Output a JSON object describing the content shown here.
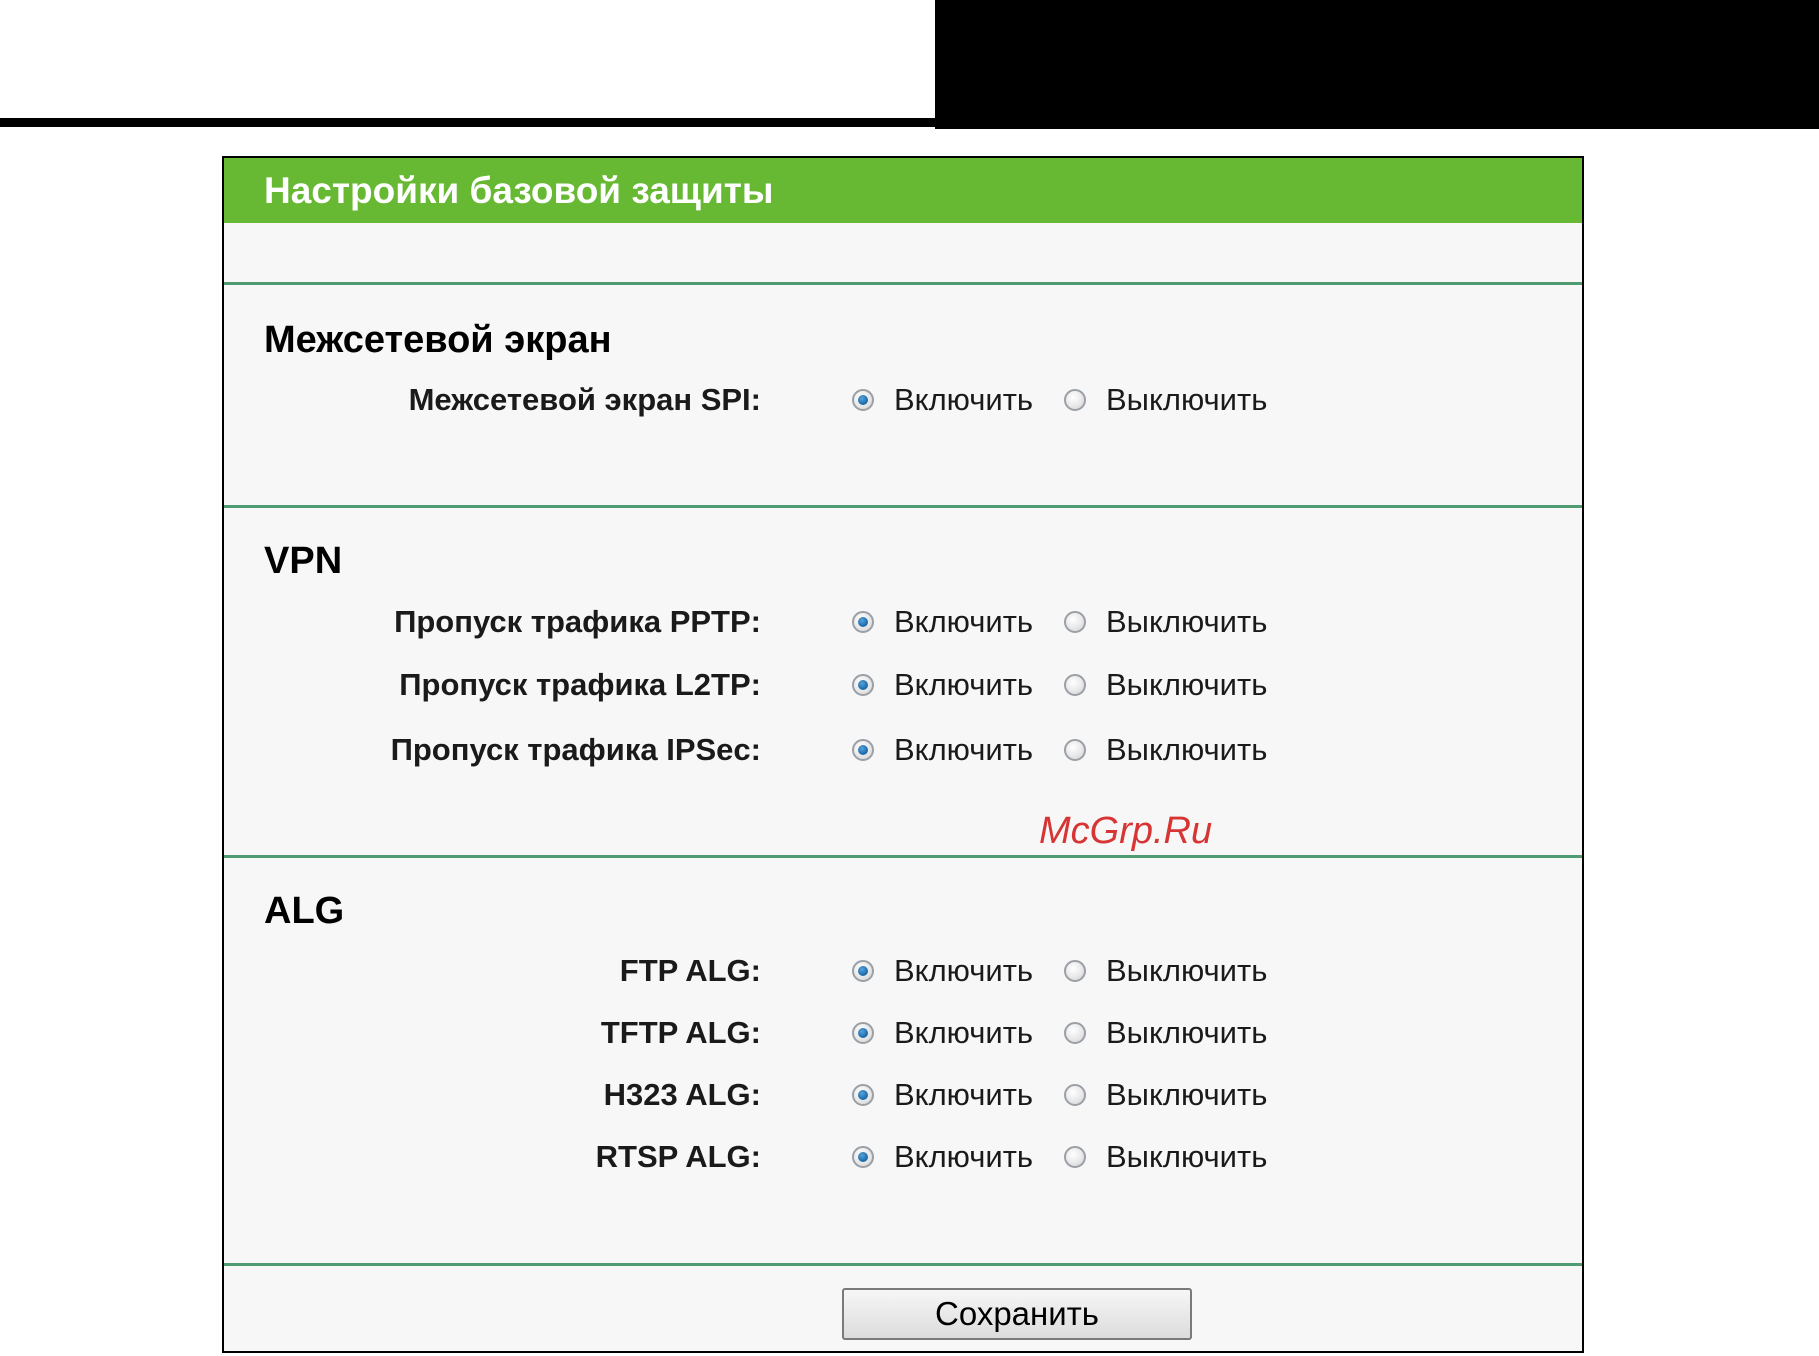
{
  "panel": {
    "title": "Настройки базовой защиты",
    "save_label": "Сохранить"
  },
  "option_labels": {
    "enable": "Включить",
    "disable": "Выключить"
  },
  "sections": [
    {
      "title": "Межсетевой экран",
      "rows": [
        {
          "label": "Межсетевой экран SPI:",
          "selected": "enable"
        }
      ]
    },
    {
      "title": "VPN",
      "rows": [
        {
          "label": "Пропуск трафика PPTP:",
          "selected": "enable"
        },
        {
          "label": "Пропуск трафика L2TP:",
          "selected": "enable"
        },
        {
          "label": "Пропуск трафика IPSec:",
          "selected": "enable"
        }
      ]
    },
    {
      "title": "ALG",
      "rows": [
        {
          "label": "FTP ALG:",
          "selected": "enable"
        },
        {
          "label": "TFTP ALG:",
          "selected": "enable"
        },
        {
          "label": "H323 ALG:",
          "selected": "enable"
        },
        {
          "label": "RTSP ALG:",
          "selected": "enable"
        }
      ]
    }
  ],
  "watermark": "McGrp.Ru",
  "colors": {
    "header_green": "#67b933",
    "divider_green": "#4f9c72",
    "radio_blue": "#1f6fb0"
  }
}
